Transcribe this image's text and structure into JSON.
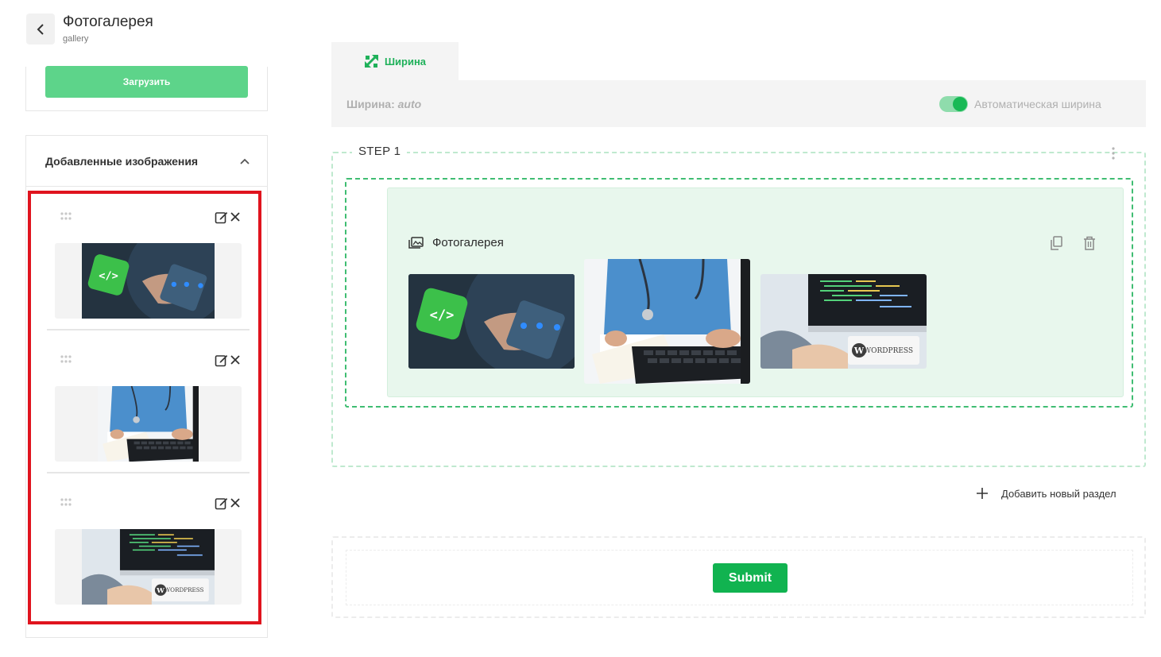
{
  "header": {
    "title": "Фотогалерея",
    "subtitle": "gallery",
    "back_icon": "chevron-left-icon"
  },
  "upload": {
    "button_label": "Загрузить"
  },
  "added_images": {
    "title": "Добавленные изображения",
    "collapse_icon": "chevron-up-icon",
    "items": [
      {
        "image": "tech-tablet-code"
      },
      {
        "image": "doctor-keyboard"
      },
      {
        "image": "wordpress-computer"
      }
    ]
  },
  "tabs": [
    {
      "label": "Ширина",
      "icon": "resize-icon",
      "active": true
    }
  ],
  "width_settings": {
    "label": "Ширина:",
    "value": "auto",
    "toggle_label": "Автоматическая ширина",
    "toggle_on": true
  },
  "step": {
    "title": "STEP 1"
  },
  "gallery_block": {
    "title": "Фотогалерея",
    "icon": "image-gallery-icon",
    "images": [
      "tech-tablet-code",
      "doctor-keyboard",
      "wordpress-computer"
    ]
  },
  "add_section": {
    "label": "Добавить новый раздел"
  },
  "submit": {
    "label": "Submit"
  },
  "colors": {
    "accent": "#11b350",
    "upload_button": "#5dd48a",
    "highlight": "#e0141e",
    "block_bg": "#e8f7ed"
  }
}
